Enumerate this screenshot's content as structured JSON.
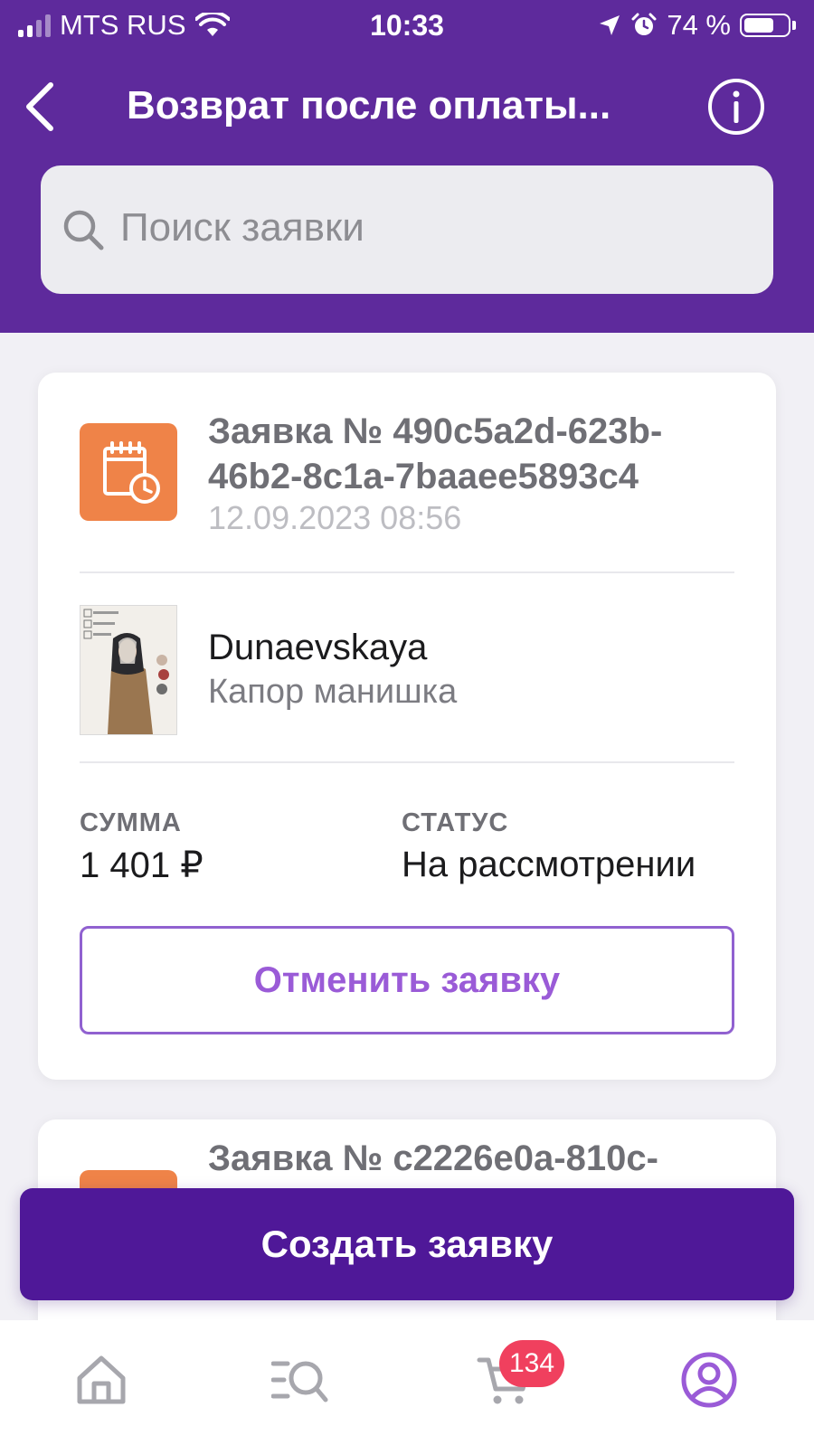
{
  "status_bar": {
    "carrier": "MTS RUS",
    "time": "10:33",
    "battery_percent": "74 %",
    "battery_level": 0.74
  },
  "nav": {
    "title": "Возврат после оплаты...",
    "back_icon": "chevron-left-icon",
    "info_icon": "info-icon"
  },
  "search": {
    "placeholder": "Поиск заявки"
  },
  "requests": [
    {
      "title": "Заявка № 490c5a2d-623b-46b2-8c1a-7baaee5893c4",
      "date": "12.09.2023 08:56",
      "brand": "Dunaevskaya",
      "product": "Капор манишка",
      "amount_label": "СУММА",
      "amount": "1 401 ₽",
      "status_label": "СТАТУС",
      "status": "На рассмотрении",
      "cancel_label": "Отменить заявку"
    },
    {
      "title": "Заявка № c2226e0a-810c-"
    }
  ],
  "actions": {
    "create_label": "Создать заявку"
  },
  "tabbar": {
    "cart_badge": "134",
    "items": [
      "home-icon",
      "catalog-search-icon",
      "cart-icon",
      "profile-icon"
    ]
  },
  "colors": {
    "header": "#5e2a9c",
    "accent": "#4f1898",
    "request_icon": "#ef8348",
    "badge": "#f0405e",
    "cancel_text": "#9a5bd7"
  }
}
